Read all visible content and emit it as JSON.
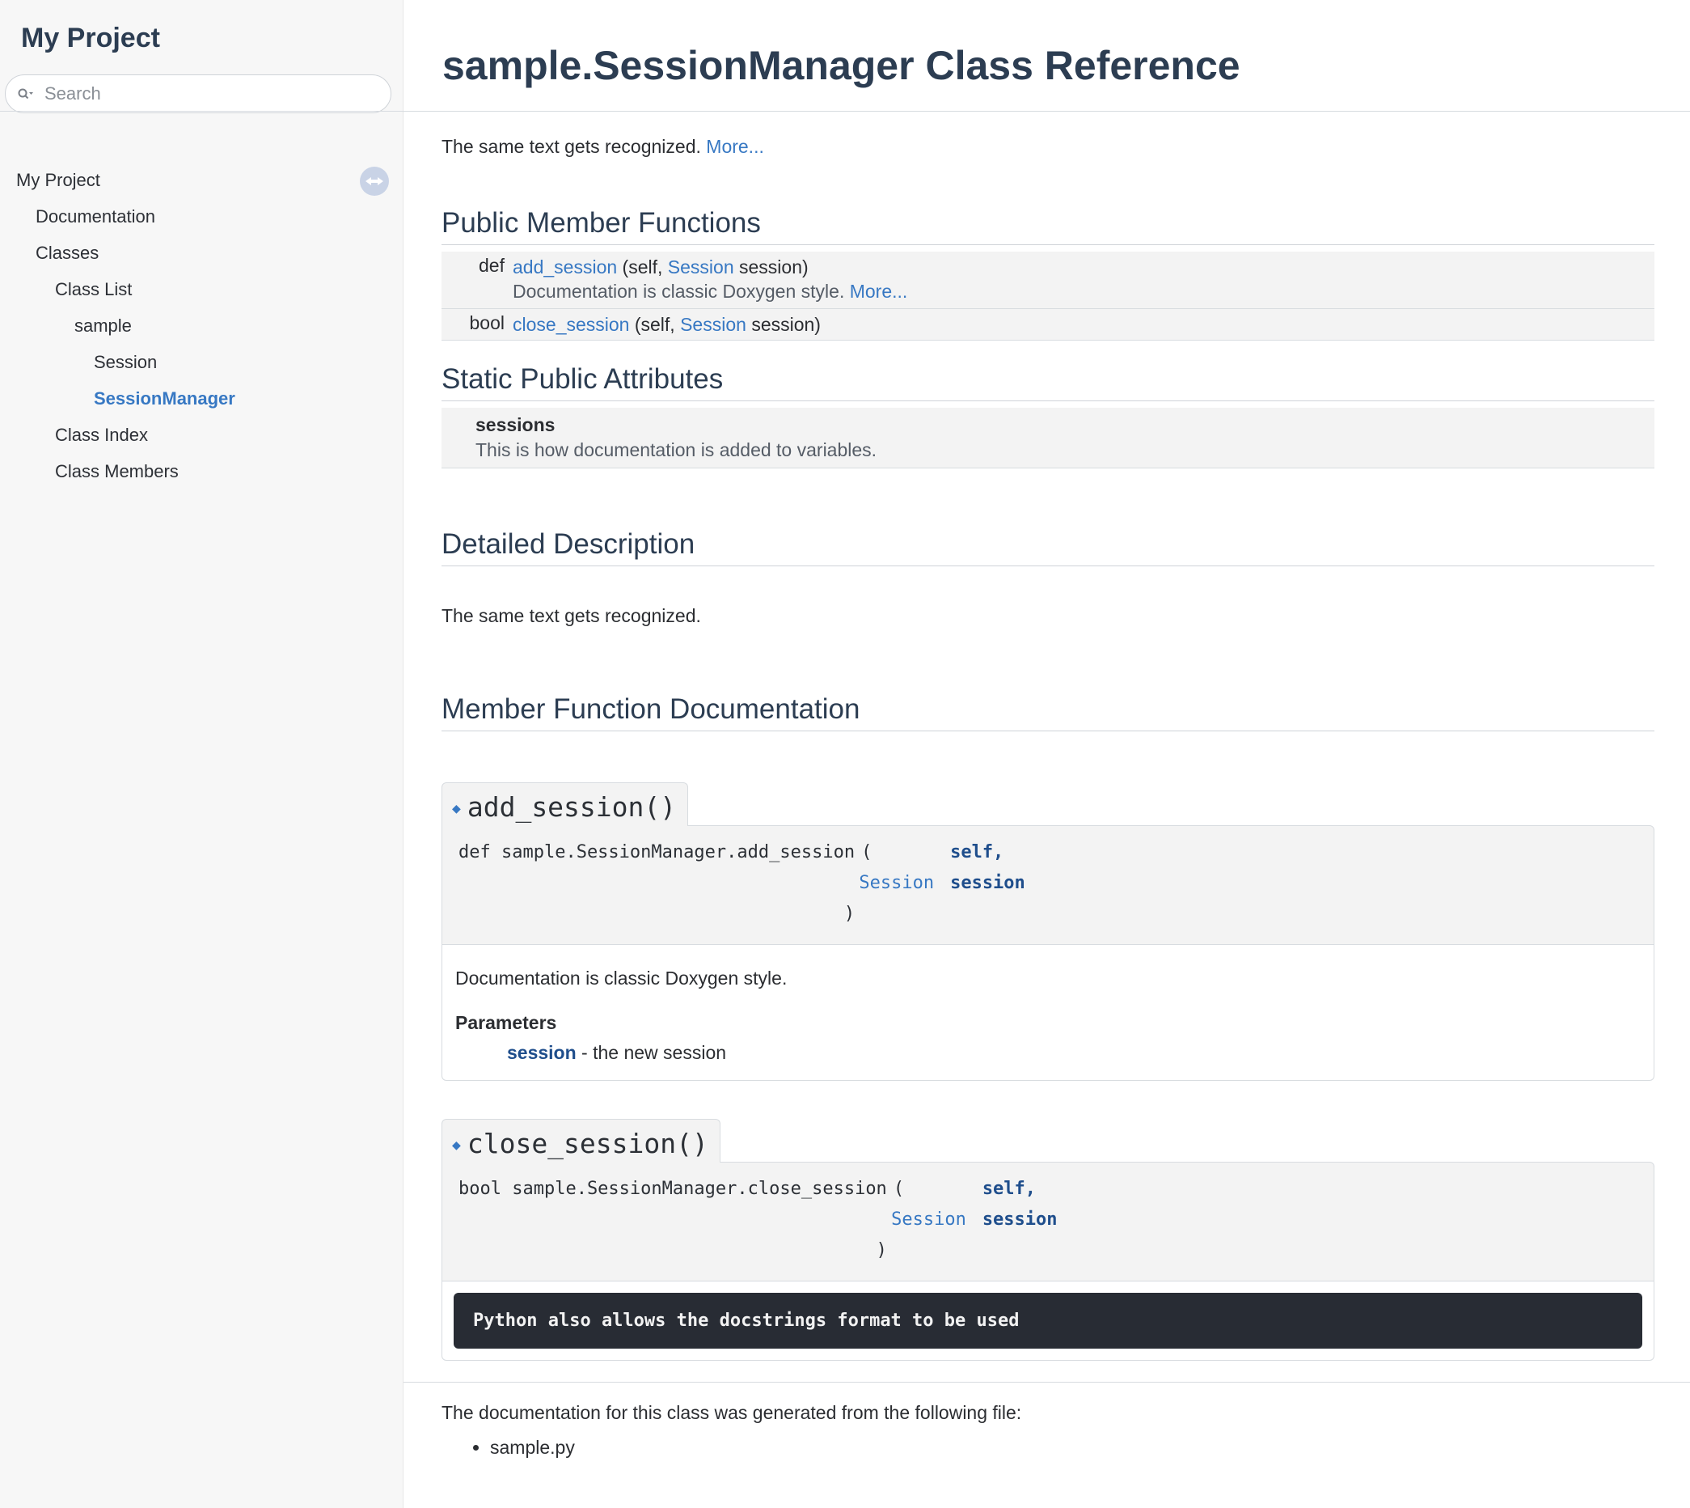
{
  "sidebar": {
    "project_name": "My Project",
    "search_placeholder": "Search",
    "tree": [
      {
        "label": "My Project",
        "indent": 0
      },
      {
        "label": "Documentation",
        "indent": 1
      },
      {
        "label": "Classes",
        "indent": 1
      },
      {
        "label": "Class List",
        "indent": 2
      },
      {
        "label": "sample",
        "indent": 3
      },
      {
        "label": "Session",
        "indent": 4
      },
      {
        "label": "SessionManager",
        "indent": 4,
        "active": true
      },
      {
        "label": "Class Index",
        "indent": 2
      },
      {
        "label": "Class Members",
        "indent": 2
      }
    ]
  },
  "page": {
    "title": "sample.SessionManager Class Reference",
    "brief": "The same text gets recognized.",
    "more_link": "More..."
  },
  "public_member_functions": {
    "heading": "Public Member Functions",
    "rows": [
      {
        "type": "def",
        "name": "add_session",
        "args_pre": "(self,",
        "arg_type": "Session",
        "args_post": "session)",
        "desc": "Documentation is classic Doxygen style.",
        "more": "More..."
      },
      {
        "type": "bool",
        "name": "close_session",
        "args_pre": "(self,",
        "arg_type": "Session",
        "args_post": "session)"
      }
    ]
  },
  "static_public_attributes": {
    "heading": "Static Public Attributes",
    "name": "sessions",
    "desc": "This is how documentation is added to variables."
  },
  "detailed_description": {
    "heading": "Detailed Description",
    "text": "The same text gets recognized."
  },
  "member_function_documentation": {
    "heading": "Member Function Documentation",
    "add_session": {
      "title": "add_session()",
      "proto_prefix": "def sample.SessionManager.add_session",
      "open_paren": "(",
      "param1_name": "self,",
      "param2_type": "Session",
      "param2_name": "session",
      "close_paren": ")",
      "desc": "Documentation is classic Doxygen style.",
      "params_label": "Parameters",
      "param_name": "session",
      "param_desc": " - the new session"
    },
    "close_session": {
      "title": "close_session()",
      "proto_prefix": "bool sample.SessionManager.close_session",
      "open_paren": "(",
      "param1_name": "self,",
      "param2_type": "Session",
      "param2_name": "session",
      "close_paren": ")",
      "code": "Python also allows the docstrings format to be used"
    }
  },
  "footer": {
    "text": "The documentation for this class was generated from the following file:",
    "files": [
      "sample.py"
    ]
  }
}
